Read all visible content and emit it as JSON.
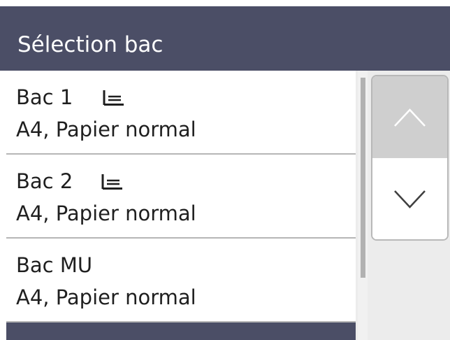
{
  "header": {
    "title": "Sélection bac"
  },
  "items": [
    {
      "name": "Bac 1",
      "description": "A4, Papier normal",
      "icon": "tray-icon"
    },
    {
      "name": "Bac 2",
      "description": "A4, Papier normal",
      "icon": "tray-icon"
    },
    {
      "name": "Bac MU",
      "description": "A4, Papier normal"
    }
  ],
  "scroll": {
    "up_icon": "chevron-up-icon",
    "down_icon": "chevron-down-icon"
  },
  "colors": {
    "title_bar": "#4b4e66",
    "text": "#1f1f1f",
    "divider": "#b6b6b6",
    "scroll_up_bg": "#cfcfcf",
    "scroll_down_bg": "#ffffff",
    "scroll_thumb": "#b1b1b1"
  }
}
